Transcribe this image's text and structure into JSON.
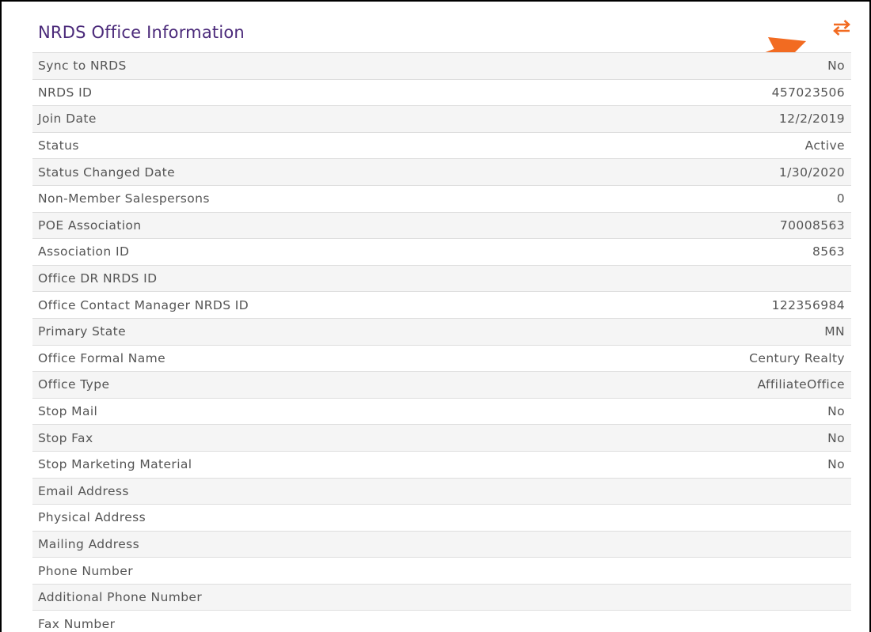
{
  "panel": {
    "title": "NRDS Office Information",
    "sync_icon": "swap-arrows-icon",
    "accent_color": "#f26b21",
    "title_color": "#4b2a7a"
  },
  "annotation": {
    "icon": "pointer-arrow-icon",
    "color": "#f26b21"
  },
  "rows": [
    {
      "label": "Sync to NRDS",
      "value": "No"
    },
    {
      "label": "NRDS ID",
      "value": "457023506"
    },
    {
      "label": "Join Date",
      "value": "12/2/2019"
    },
    {
      "label": "Status",
      "value": "Active"
    },
    {
      "label": "Status Changed Date",
      "value": "1/30/2020"
    },
    {
      "label": "Non-Member Salespersons",
      "value": "0"
    },
    {
      "label": "POE Association",
      "value": "70008563"
    },
    {
      "label": "Association ID",
      "value": "8563"
    },
    {
      "label": "Office DR NRDS ID",
      "value": ""
    },
    {
      "label": "Office Contact Manager NRDS ID",
      "value": "122356984"
    },
    {
      "label": "Primary State",
      "value": "MN"
    },
    {
      "label": "Office Formal Name",
      "value": "Century Realty"
    },
    {
      "label": "Office Type",
      "value": "AffiliateOffice"
    },
    {
      "label": "Stop Mail",
      "value": "No"
    },
    {
      "label": "Stop Fax",
      "value": "No"
    },
    {
      "label": "Stop Marketing Material",
      "value": "No"
    },
    {
      "label": "Email Address",
      "value": ""
    },
    {
      "label": "Physical Address",
      "value": ""
    },
    {
      "label": "Mailing Address",
      "value": ""
    },
    {
      "label": "Phone Number",
      "value": ""
    },
    {
      "label": "Additional Phone Number",
      "value": ""
    },
    {
      "label": "Fax Number",
      "value": ""
    }
  ]
}
